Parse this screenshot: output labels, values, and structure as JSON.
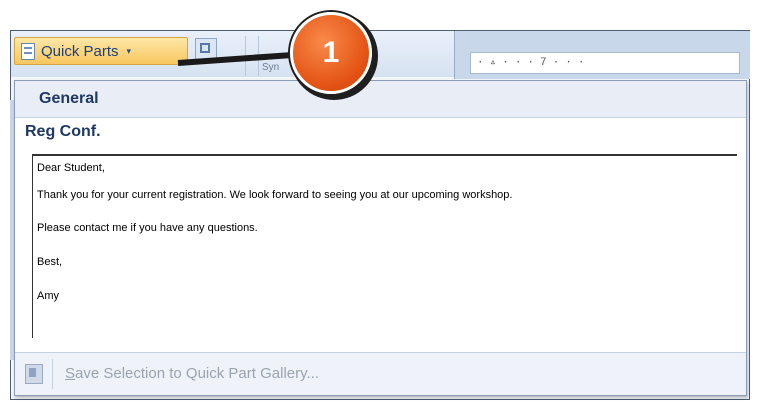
{
  "ribbon": {
    "quick_parts_label": "Quick Parts",
    "quick_parts_arrow": "▾",
    "ribbon_caption": "Syn",
    "ruler_text": "·▵···7···"
  },
  "callout": {
    "number": "1",
    "color": "#e45415"
  },
  "dropdown": {
    "section_header": "General",
    "entry_name": "Reg Conf.",
    "preview_lines": [
      "Dear Student,",
      "Thank you for your current registration. We look forward to seeing you at our upcoming workshop.",
      "Please contact me if you have any questions.",
      "Best,",
      "Amy"
    ],
    "footer_action_prefix": "S",
    "footer_action_rest": "ave Selection to Quick Part Gallery..."
  }
}
